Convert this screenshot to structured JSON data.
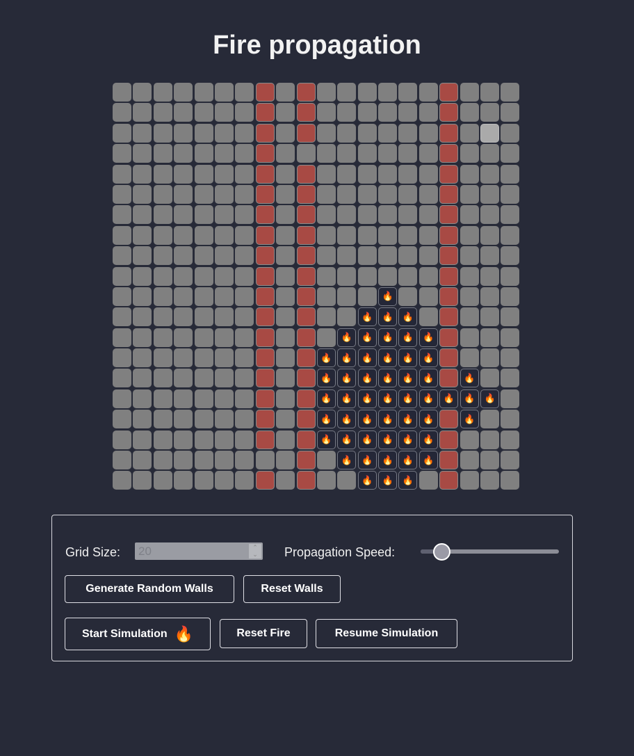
{
  "title": "Fire propagation",
  "grid": {
    "size": 20,
    "legend": {
      "W": "wall",
      "F": "fire",
      ".": "empty",
      "H": "hovered"
    },
    "fire_icon": "fire-icon",
    "colors": {
      "empty": "#808080",
      "wall": "#a84a44",
      "fire_bg": "#242737",
      "hovered": "#aaaaaa"
    },
    "rows": [
      ".......W.W......W...",
      ".......W.W......W...",
      ".......W.W......W.H.",
      ".......W........W...",
      ".......W.W......W...",
      ".......W.W......W...",
      ".......W.W......W...",
      ".......W.W......W...",
      ".......W.W......W...",
      ".......W.W......W...",
      ".......W.W...F..W...",
      ".......W.W..FFF.W...",
      ".......W.W.FFFFFW...",
      ".......W.WFFFFFFW...",
      ".......W.WFFFFFFWF..",
      ".......W.WFFFFFFFFF.",
      ".......W.WFFFFFFWF..",
      ".......W.WFFFFFFW...",
      ".........W.FFFFFW...",
      ".......W.W..FFF.W..."
    ]
  },
  "controls": {
    "grid_size_label": "Grid Size:",
    "grid_size_value": "20",
    "speed_label": "Propagation Speed:",
    "speed_fraction": 0.15,
    "generate_walls": "Generate Random Walls",
    "reset_walls": "Reset Walls",
    "start_simulation": "Start Simulation",
    "start_icon": "🔥",
    "reset_fire": "Reset Fire",
    "resume_simulation": "Resume Simulation"
  }
}
